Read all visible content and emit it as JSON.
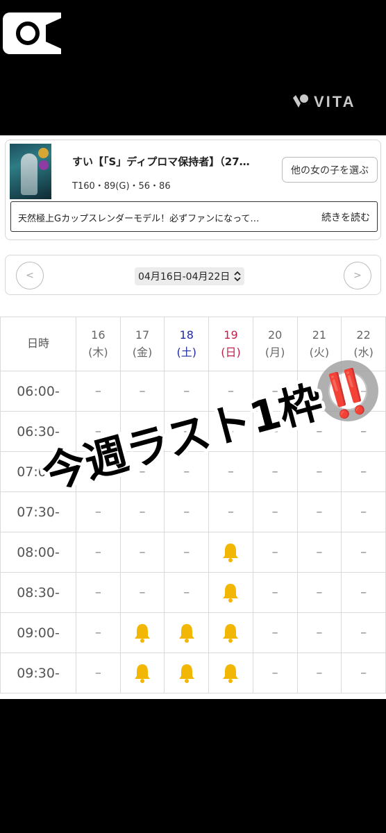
{
  "app": {
    "watermark": "VITA"
  },
  "profile": {
    "name": "すい【「S」ディプロマ保持者】（27…",
    "stats": "T160・89(G)・56・86",
    "choose_button": "他の女の子を選ぶ",
    "description": "天然極上Gカップスレンダーモデル！必ずファンになって…",
    "read_more": "続きを読む"
  },
  "week_nav": {
    "prev": "<",
    "next": ">",
    "range": "04月16日-04月22日",
    "range_icon": "⌃⌄"
  },
  "schedule": {
    "header_label": "日時",
    "days": [
      {
        "num": "16",
        "dow": "(木)",
        "type": "weekday"
      },
      {
        "num": "17",
        "dow": "(金)",
        "type": "weekday"
      },
      {
        "num": "18",
        "dow": "(土)",
        "type": "sat"
      },
      {
        "num": "19",
        "dow": "(日)",
        "type": "sun"
      },
      {
        "num": "20",
        "dow": "(月)",
        "type": "weekday"
      },
      {
        "num": "21",
        "dow": "(火)",
        "type": "weekday"
      },
      {
        "num": "22",
        "dow": "(水)",
        "type": "weekday"
      }
    ],
    "empty_mark": "–",
    "rows": [
      {
        "time": "06:00-",
        "cells": [
          "-",
          "-",
          "-",
          "-",
          "-",
          "-",
          "-"
        ]
      },
      {
        "time": "06:30-",
        "cells": [
          "-",
          "-",
          "-",
          "-",
          "-",
          "-",
          "-"
        ]
      },
      {
        "time": "07:00-",
        "cells": [
          "-",
          "-",
          "-",
          "-",
          "-",
          "-",
          "-"
        ]
      },
      {
        "time": "07:30-",
        "cells": [
          "-",
          "-",
          "-",
          "-",
          "-",
          "-",
          "-"
        ]
      },
      {
        "time": "08:00-",
        "cells": [
          "-",
          "-",
          "-",
          "bell",
          "-",
          "-",
          "-"
        ]
      },
      {
        "time": "08:30-",
        "cells": [
          "-",
          "-",
          "-",
          "bell",
          "-",
          "-",
          "-"
        ]
      },
      {
        "time": "09:00-",
        "cells": [
          "-",
          "bell",
          "bell",
          "bell",
          "-",
          "-",
          "-"
        ]
      },
      {
        "time": "09:30-",
        "cells": [
          "-",
          "bell",
          "bell",
          "bell",
          "-",
          "-",
          "-"
        ]
      }
    ]
  },
  "overlay": {
    "stamp_text": "今週ラスト1枠‼️"
  },
  "colors": {
    "saturday": "#1e2ba0",
    "sunday": "#c0204a",
    "bell": "#f2b705"
  }
}
